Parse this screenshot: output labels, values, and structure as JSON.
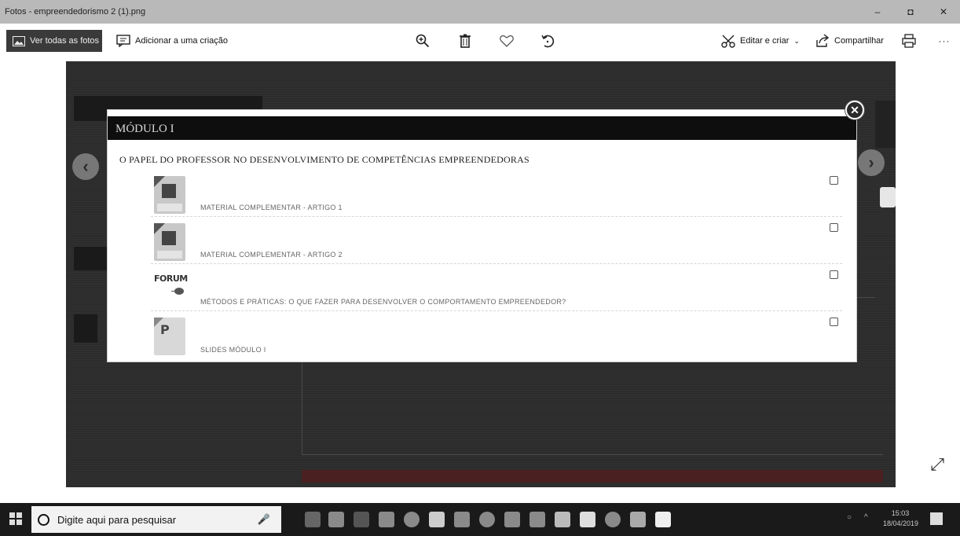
{
  "window": {
    "title": "Fotos - empreendedorismo 2 (1).png",
    "controls": [
      "–",
      "◘",
      "✕"
    ]
  },
  "toolbar": {
    "view_all": "Ver todas as fotos",
    "add_to_creation": "Adicionar a uma criação",
    "edit_create": "Editar e criar",
    "share": "Compartilhar",
    "more": "···"
  },
  "modal": {
    "header": "MÓDULO I",
    "title": "O PAPEL DO PROFESSOR NO DESENVOLVIMENTO DE COMPETÊNCIAS EMPREENDEDORAS",
    "items": [
      {
        "label": "MATERIAL COMPLEMENTAR - ARTIGO 1",
        "icon": "pdf-icon"
      },
      {
        "label": "MATERIAL COMPLEMENTAR - ARTIGO 2",
        "icon": "pdf-icon"
      },
      {
        "label": "MÉTODOS E PRÁTICAS: O QUE FAZER PARA DESENVOLVER O COMPORTAMENTO EMPREENDEDOR?",
        "icon": "forum-icon",
        "icon_text": "FORUM"
      },
      {
        "label": "SLIDES MÓDULO I",
        "icon": "ppt-icon",
        "icon_text": "P"
      }
    ]
  },
  "taskbar": {
    "search_placeholder": "Digite aqui para pesquisar",
    "time": "15:03",
    "date": "18/04/2019"
  }
}
